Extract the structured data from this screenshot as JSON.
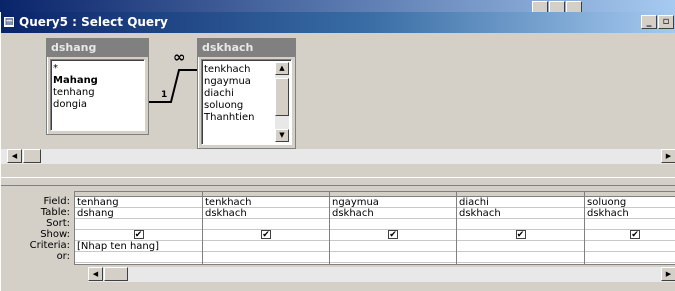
{
  "background_window": {
    "title": "",
    "accent": "#0a246a"
  },
  "window": {
    "title": "Query5 : Select Query",
    "icon": "query-icon",
    "titlebar_color": "#0a246a"
  },
  "tables": [
    {
      "name": "dshang",
      "fields": [
        "*",
        "Mahang",
        "tenhang",
        "dongia"
      ],
      "bold_field": "Mahang"
    },
    {
      "name": "dskhach",
      "fields": [
        "tenkhach",
        "ngaymua",
        "diachi",
        "soluong",
        "Thanhtien"
      ]
    }
  ],
  "relationship": {
    "from_label": "1",
    "to_label": "∞"
  },
  "grid": {
    "row_labels": [
      "Field:",
      "Table:",
      "Sort:",
      "Show:",
      "Criteria:",
      "or:"
    ],
    "columns": [
      {
        "field": "tenhang",
        "table": "dshang",
        "sort": "",
        "show": true,
        "criteria": "[Nhap ten hang]",
        "or": ""
      },
      {
        "field": "tenkhach",
        "table": "dskhach",
        "sort": "",
        "show": true,
        "criteria": "",
        "or": ""
      },
      {
        "field": "ngaymua",
        "table": "dskhach",
        "sort": "",
        "show": true,
        "criteria": "",
        "or": ""
      },
      {
        "field": "diachi",
        "table": "dskhach",
        "sort": "",
        "show": true,
        "criteria": "",
        "or": ""
      },
      {
        "field": "soluong",
        "table": "dskhach",
        "sort": "",
        "show": true,
        "criteria": "",
        "or": ""
      }
    ]
  },
  "icons": {
    "minimize": "minimize-icon",
    "restore": "restore-icon",
    "scroll_up": "arrow-up-icon",
    "scroll_down": "arrow-down-icon",
    "scroll_left": "arrow-left-icon",
    "scroll_right": "arrow-right-icon",
    "checkmark": "checkmark-icon"
  }
}
